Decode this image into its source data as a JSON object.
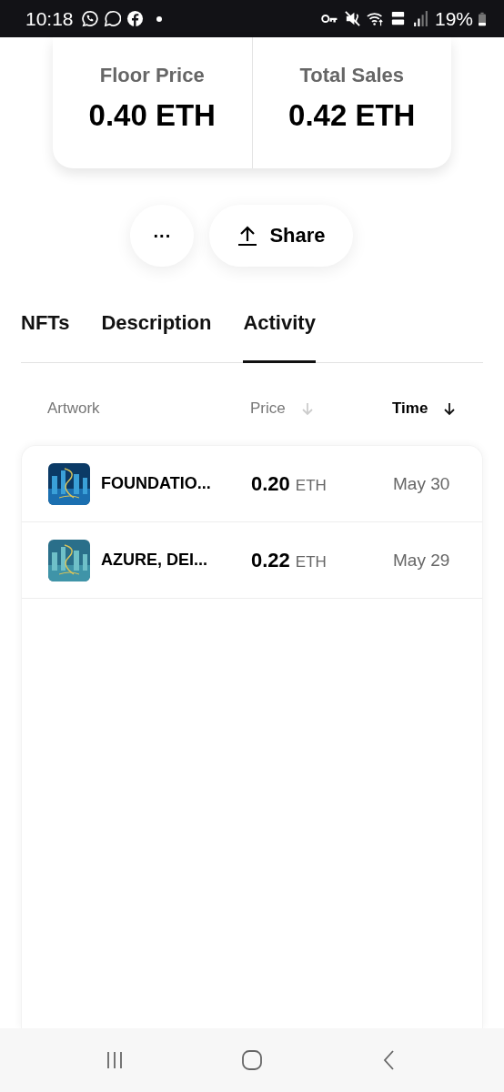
{
  "status_bar": {
    "time": "10:18",
    "battery": "19%"
  },
  "stats": [
    {
      "label": "Floor Price",
      "value": "0.40 ETH"
    },
    {
      "label": "Total Sales",
      "value": "0.42 ETH"
    }
  ],
  "actions": {
    "more": "···",
    "share": "Share"
  },
  "tabs": [
    {
      "label": "NFTs",
      "selected": false
    },
    {
      "label": "Description",
      "selected": false
    },
    {
      "label": "Activity",
      "selected": true
    }
  ],
  "table": {
    "columns": [
      {
        "label": "Artwork",
        "sortable": false,
        "selected": false
      },
      {
        "label": "Price",
        "sortable": true,
        "selected": false
      },
      {
        "label": "Time",
        "sortable": true,
        "selected": true
      }
    ],
    "rows": [
      {
        "artwork": "FOUNDATIO...",
        "price": "0.20",
        "currency": "ETH",
        "time": "May 30"
      },
      {
        "artwork": "AZURE, DEI...",
        "price": "0.22",
        "currency": "ETH",
        "time": "May 29"
      }
    ]
  }
}
